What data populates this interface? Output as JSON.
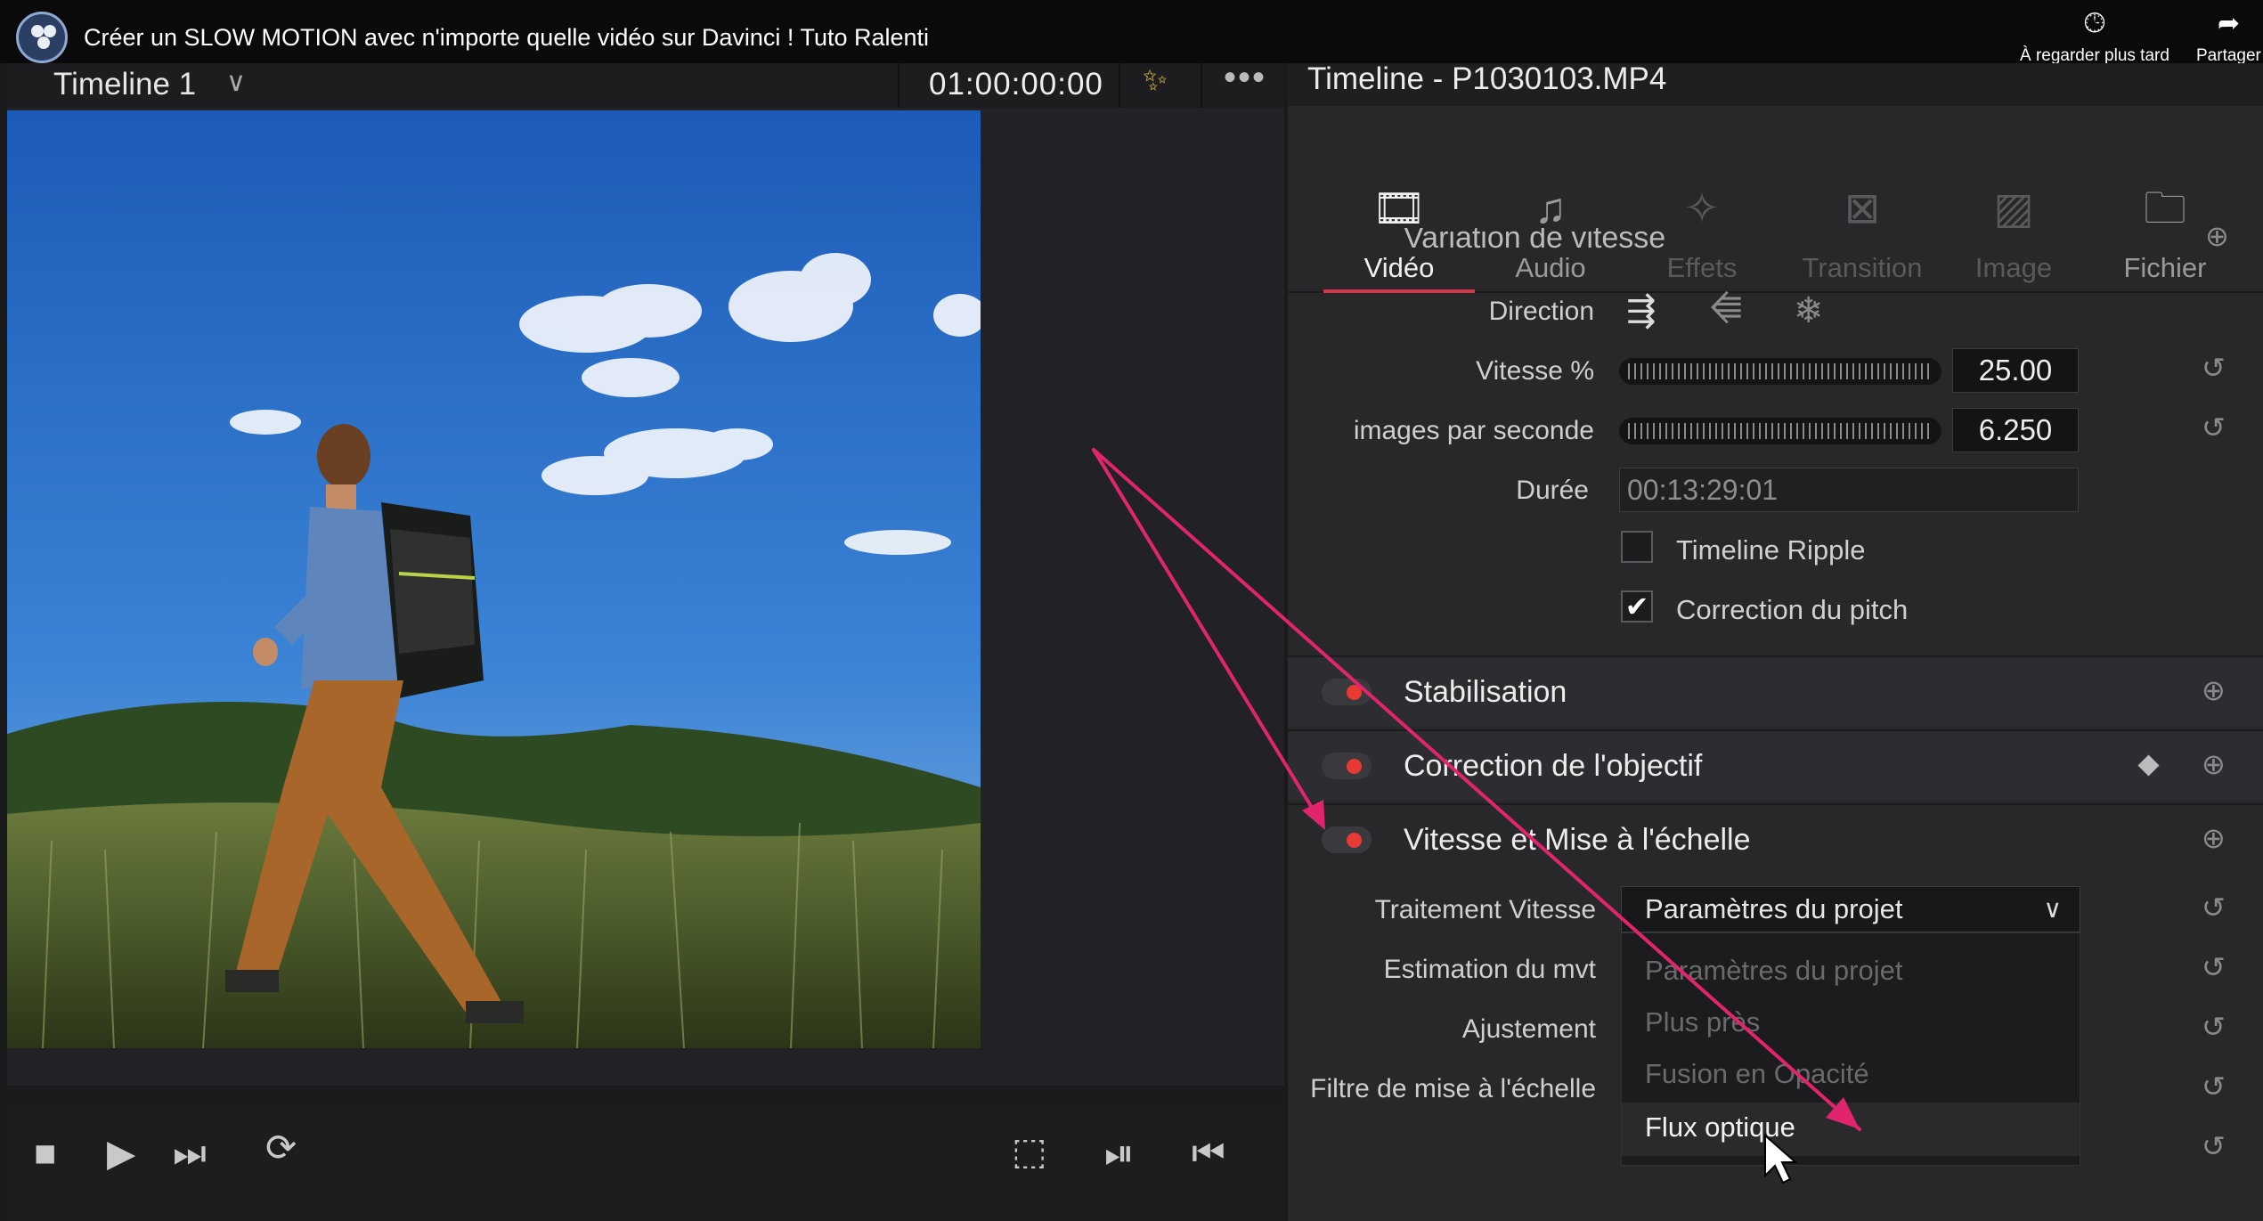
{
  "video": {
    "title": "Créer un SLOW MOTION avec n'importe quelle vidéo sur Davinci ! Tuto Ralenti",
    "watch_later": "À regarder plus tard",
    "share": "Partager"
  },
  "viewer": {
    "timeline_name": "Timeline 1",
    "timecode": "01:00:00:00"
  },
  "inspector": {
    "title": "Timeline - P1030103.MP4",
    "tabs": [
      {
        "label": "Vidéo",
        "icon": "film-icon",
        "state": "active"
      },
      {
        "label": "Audio",
        "icon": "music-note-icon",
        "state": "normal"
      },
      {
        "label": "Effets",
        "icon": "magic-wand-icon",
        "state": "disabled"
      },
      {
        "label": "Transition",
        "icon": "transition-icon",
        "state": "disabled"
      },
      {
        "label": "Image",
        "icon": "image-icon",
        "state": "disabled"
      },
      {
        "label": "Fichier",
        "icon": "file-icon",
        "state": "normal"
      }
    ],
    "speed_change": {
      "section": "Variation de vitesse",
      "direction_label": "Direction",
      "speed_label": "Vitesse %",
      "speed_value": "25.00",
      "speed_fill": 0.25,
      "fps_label": "images par seconde",
      "fps_value": "6.250",
      "duration_label": "Durée",
      "duration_value": "00:13:29:01",
      "ripple_label": "Timeline Ripple",
      "ripple_checked": false,
      "pitch_label": "Correction du pitch",
      "pitch_checked": true
    },
    "sections": {
      "stabilization": "Stabilisation",
      "lens_correction": "Correction de l'objectif",
      "retime_scaling": "Vitesse et Mise à l'échelle"
    },
    "retime": {
      "process_label": "Traitement Vitesse",
      "process_value": "Paramètres du projet",
      "motion_label": "Estimation du mvt",
      "adjust_label": "Ajustement",
      "filter_label": "Filtre de mise à l'échelle",
      "options": [
        "Paramètres du projet",
        "Plus près",
        "Fusion en Opacité",
        "Flux optique"
      ],
      "highlighted_option": "Flux optique"
    }
  },
  "colors": {
    "accent_red": "#e63a32",
    "annotation_pink": "#e0256e",
    "tab_underline": "#d6344a"
  }
}
